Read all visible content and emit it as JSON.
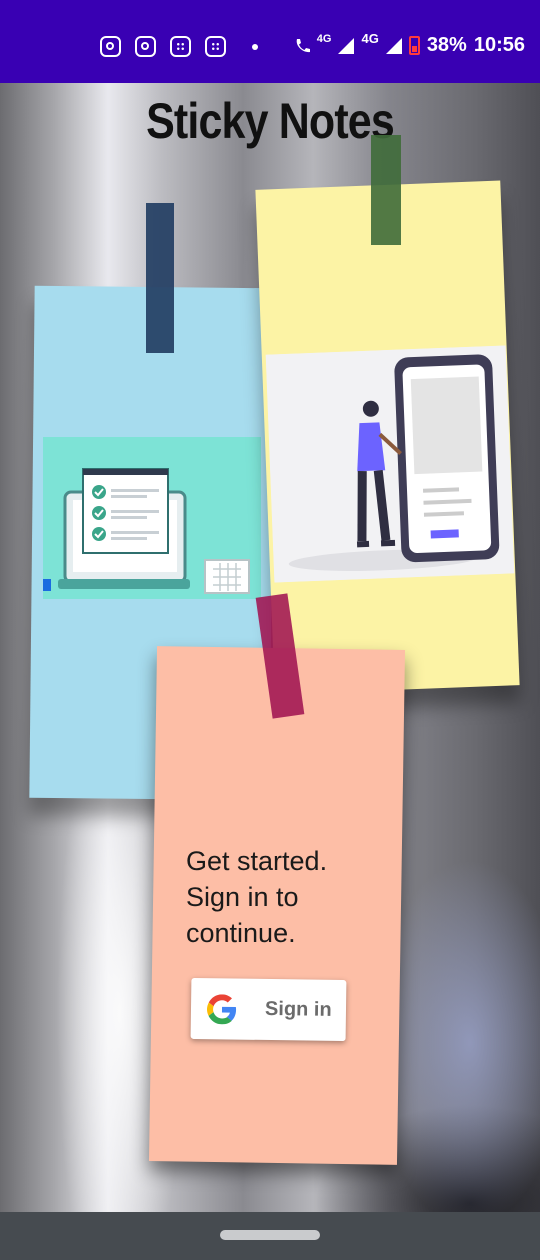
{
  "status_bar": {
    "left_icons": [
      "instagram-icon",
      "instagram-icon",
      "grid-app-icon",
      "grid-app-icon",
      "dot-icon"
    ],
    "network_label_1": "4G",
    "network_label_2": "4G",
    "battery": "38%",
    "time": "10:56",
    "background_color": "#3900b3"
  },
  "app": {
    "title": "Sticky Notes"
  },
  "sign_in_note": {
    "cta_line_1": "Get started.",
    "cta_line_2": "Sign in to",
    "cta_line_3": "continue.",
    "button_label": "Sign in"
  },
  "notes_colors": {
    "blue": "#a7dcee",
    "yellow": "#fcf3a5",
    "pink": "#fdbea6"
  }
}
